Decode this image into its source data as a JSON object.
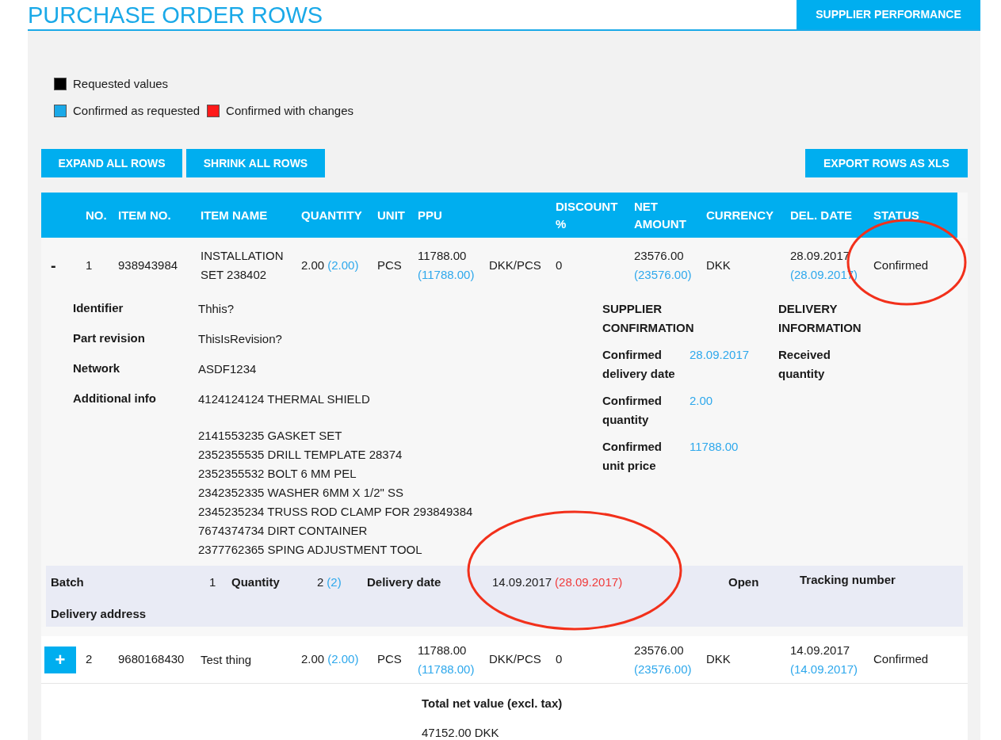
{
  "title": "PURCHASE ORDER ROWS",
  "header_button": "SUPPLIER PERFORMANCE",
  "legend": [
    {
      "label": "Requested values",
      "color": "#000000"
    },
    {
      "label": "Confirmed as requested",
      "color": "#1aa9e8"
    },
    {
      "label": "Confirmed with changes",
      "color": "#ff1a1a"
    }
  ],
  "actions": [
    "EXPAND ALL ROWS",
    "SHRINK ALL ROWS"
  ],
  "export_button": "EXPORT ROWS AS XLS",
  "table": {
    "columns": [
      "NO.",
      "ITEM NO.",
      "ITEM NAME",
      "QUANTITY",
      "UNIT",
      "PPU",
      "DISCOUNT %",
      "NET AMOUNT",
      "CURRENCY",
      "DEL. DATE",
      "STATUS"
    ],
    "rows": [
      {
        "toggle": "-",
        "expanded": true,
        "no": "1",
        "item_no": "938943984",
        "item_name": "INSTALLATION SET 238402",
        "quantity": {
          "requested": "2.00",
          "confirmed": "(2.00)",
          "changed": false
        },
        "unit": "PCS",
        "ppu": {
          "requested": "11788.00",
          "confirmed": "(11788.00)",
          "changed": false
        },
        "price_unit": "DKK/PCS",
        "discount": "0",
        "net_amount": {
          "requested": "23576.00",
          "confirmed": "(23576.00)",
          "changed": false
        },
        "currency": "DKK",
        "del_date": {
          "requested": "28.09.2017",
          "confirmed": "(28.09.2017)",
          "changed": false
        },
        "status": "Confirmed",
        "details": {
          "fields": [
            {
              "label": "Identifier",
              "value": [
                "Thhis?"
              ]
            },
            {
              "label": "Part revision",
              "value": [
                "ThisIsRevision?"
              ]
            },
            {
              "label": "Network",
              "value": [
                "ASDF1234"
              ]
            },
            {
              "label": "Additional info",
              "value": [
                "4124124124 THERMAL SHIELD"
              ],
              "more": [
                "2141553235 GASKET SET",
                "2352355535 DRILL TEMPLATE 28374",
                "2352355532 BOLT 6 MM PEL",
                "2342352335 WASHER 6MM X 1/2\" SS",
                "2345235234 TRUSS ROD CLAMP FOR 293849384",
                "7674374734 DIRT CONTAINER",
                "2377762365 SPING ADJUSTMENT TOOL"
              ]
            }
          ],
          "supplier_confirmation": {
            "heading": "SUPPLIER CONFIRMATION",
            "fields": [
              {
                "label": "Confirmed delivery date",
                "value": "28.09.2017"
              },
              {
                "label": "Confirmed quantity",
                "value": "2.00"
              },
              {
                "label": "Confirmed unit price",
                "value": "11788.00"
              }
            ]
          },
          "delivery_information": {
            "heading": "DELIVERY INFORMATION",
            "fields": [
              {
                "label": "Received quantity"
              }
            ]
          }
        },
        "batch": {
          "label": "Batch",
          "number": "1",
          "quantity_label": "Quantity",
          "quantity": "2",
          "quantity_confirmed": "(2)",
          "quantity_changed": false,
          "date_label": "Delivery date",
          "date": "14.09.2017",
          "date_confirmed": "(28.09.2017)",
          "date_changed": true,
          "state": "Open",
          "tracking_label": "Tracking number",
          "address_label": "Delivery address"
        }
      },
      {
        "toggle": "+",
        "expanded": false,
        "no": "2",
        "item_no": "9680168430",
        "item_name": "Test thing",
        "quantity": {
          "requested": "2.00",
          "confirmed": "(2.00)",
          "changed": false
        },
        "unit": "PCS",
        "ppu": {
          "requested": "11788.00",
          "confirmed": "(11788.00)",
          "changed": false
        },
        "price_unit": "DKK/PCS",
        "discount": "0",
        "net_amount": {
          "requested": "23576.00",
          "confirmed": "(23576.00)",
          "changed": false
        },
        "currency": "DKK",
        "del_date": {
          "requested": "14.09.2017",
          "confirmed": "(14.09.2017)",
          "changed": false
        },
        "status": "Confirmed"
      }
    ],
    "total_label": "Total net value (excl. tax)",
    "total_value": "47152.00 DKK"
  },
  "annotations": [
    {
      "kind": "ellipse"
    },
    {
      "kind": "ellipse"
    }
  ]
}
